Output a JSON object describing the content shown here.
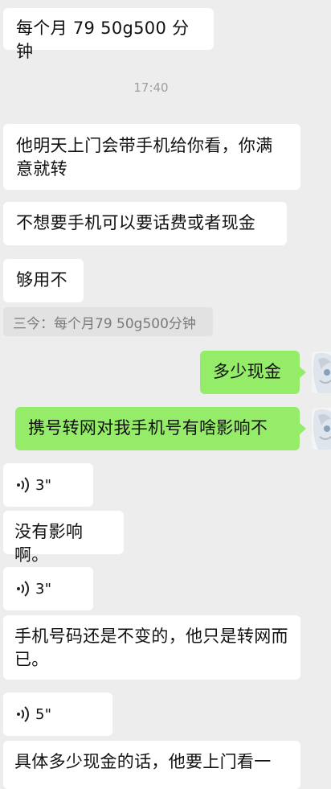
{
  "messages": {
    "m1": "每个月 79 50g500 分钟",
    "m2": "他明天上门会带手机给你看，你满意就转",
    "m3": "不想要手机可以要话费或者现金",
    "m4": "够用不",
    "m5": "多少现金",
    "m6": "携号转网对我手机号有啥影响不",
    "m7": "没有影响啊。",
    "m8": "手机号码还是不变的，他只是转网而已。",
    "m9": "具体多少现金的话，他要上门看一"
  },
  "timestamp": "17:40",
  "quote": "三今：每个月79 50g500分钟",
  "voice": {
    "v1": "3\"",
    "v2": "3\"",
    "v3": "5\""
  },
  "colors": {
    "background": "#ededed",
    "incoming": "#ffffff",
    "outgoing": "#95ec69"
  },
  "icons": {
    "voice": "voice-wave-icon",
    "avatar": "anime-character-avatar"
  }
}
